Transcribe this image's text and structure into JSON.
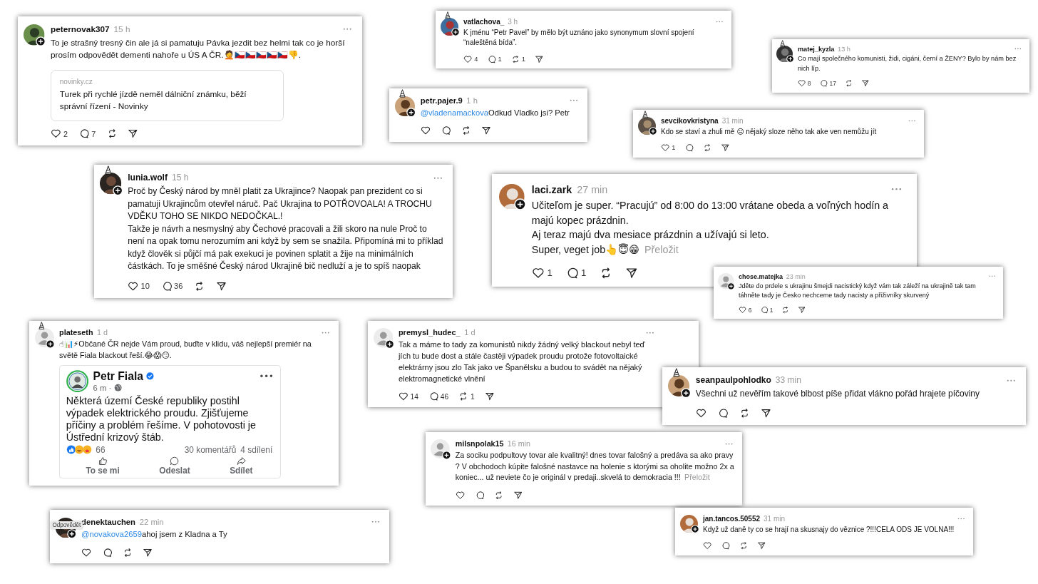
{
  "posts": [
    {
      "user": "peternovak307",
      "time": "15 h",
      "avatar": {
        "kind": "photo",
        "hat": false
      },
      "text": "To je strašný tresný čin ale já si pamatuju Pávka jezdit bez helmi tak co je horší prosím odpovědět dementi nahoře u ÚS A ČR.🤦🇨🇿🇨🇿🇨🇿🇨🇿🇨🇿👎.",
      "link_preview": {
        "source": "novinky.cz",
        "title": "Turek při rychlé jízdě neměl dálniční známku, běží správní řízení - Novinky"
      },
      "likes": "2",
      "comments": "7"
    },
    {
      "user": "vatlachova_",
      "time": "3 h",
      "avatar": {
        "kind": "photo",
        "hat": true
      },
      "text": "K jménu “Petr Pavel” by mělo být uznáno jako synonymum slovní spojení “naleštěná bída”.",
      "likes": "4",
      "comments": "1",
      "reposts": "1"
    },
    {
      "user": "matej_kyzla",
      "time": "13 h",
      "avatar": {
        "kind": "photo",
        "hat": true
      },
      "text": "Co mají společného komunisti, židi, cigáni, černí a ŽENY? Bylo by nám bez nich líp.",
      "likes": "8",
      "comments": "17"
    },
    {
      "user": "petr.pajer.9",
      "time": "1 h",
      "avatar": {
        "kind": "photo",
        "hat": true
      },
      "mention": "@vladenamackova",
      "text": "Odkud Vladko jsi? Petr"
    },
    {
      "user": "sevcikovkristyna",
      "time": "31 min",
      "avatar": {
        "kind": "photo",
        "hat": true
      },
      "text": "Kdo se staví a zhuli mě 😑 nějaký sloze něho tak ake ven nemůžu jít",
      "likes": "1"
    },
    {
      "user": "lunia.wolf",
      "time": "15 h",
      "avatar": {
        "kind": "photo",
        "hat": true
      },
      "text": "Proč by Český národ by mněl platit za Ukrajince? Naopak pan prezident co si pamatuji Ukrajincům otevřel náruč. Pač Ukrajina to POTŘOVOALA! A TROCHU VDĚKU TOHO SE NIKDO NEDOČKAL.!\nTakže je návrh a nesmyslný aby Čechové pracovali a žili skoro na nule Proč to není na opak tomu nerozumím ani když by sem se snažila. Připomíná mi to příklad když člověk si půjčí má pak exekuci je povinen splatit a žije na minimálních částkách. To je směšné Český národ Ukrajině bič nedluží a je to spíš naopak",
      "likes": "10",
      "comments": "36"
    },
    {
      "user": "laci.zark",
      "time": "27 min",
      "avatar": {
        "kind": "photo",
        "hat": false
      },
      "text": "Učiteľom je super. “Pracujú” od 8:00 do 13:00 vrátane obeda a voľných hodín a majú kopec prázdnin.\nAj teraz majú dva mesiace prázdnin a užívajú si leto.\nSuper, veget job👆😇😁",
      "translate": "Přeložit",
      "likes": "1",
      "comments": "1"
    },
    {
      "user": "chose.matejka",
      "time": "23 min",
      "avatar": {
        "kind": "silhouette",
        "hat": false
      },
      "text": "Jděte do prdele s ukrajinu šmejdi nacistický když vám tak záleží na ukrajině tak tam táhněte tady je Česko nechceme tady nacisty a přiživníky skurvený",
      "likes": "6",
      "comments": "1"
    },
    {
      "user": "plateseth",
      "time": "1 d",
      "avatar": {
        "kind": "silhouette",
        "hat": true
      },
      "text": "☝📊⚡Občané ČR nejde Vám proud, buďte v klidu, váš nejlepší premiér na světě Fiala blackout řeší.😂😱😏.",
      "embed": {
        "author": "Petr Fiala",
        "verified": true,
        "time": "6 m ·",
        "text": "Některá území České republiky postihl výpadek elektrického proudu. Zjišťujeme příčiny a problém řešíme. V pohotovosti je Ústřední krizový štáb.",
        "reactions": "66",
        "comments": "30 komentářů",
        "shares": "4 sdílení",
        "actions": [
          {
            "kind": "like",
            "label": "To se mi"
          },
          {
            "kind": "send",
            "label": "Odeslat"
          },
          {
            "kind": "share",
            "label": "Sdílet"
          }
        ]
      }
    },
    {
      "user": "premysl_hudec_",
      "time": "1 d",
      "avatar": {
        "kind": "silhouette",
        "hat": false
      },
      "text": "Tak a máme to tady za komunistů nikdy žádný velký blackout nebyl teď jích tu bude dost a stále častěji výpadek proudu protože fotovoltaické elektrárny jsou zlo Tak jako ve Španělsku a budou to svádět na nějaký elektromagnetické vlnění",
      "likes": "14",
      "comments": "46",
      "reposts": "1"
    },
    {
      "user": "seanpaulpohlodko",
      "time": "33 min",
      "avatar": {
        "kind": "photo",
        "hat": true
      },
      "text": "Všechni už nevěřím takové blbost píše přidat vlákno pořád hrajete píčoviny"
    },
    {
      "user": "milsnpolak15",
      "time": "16 min",
      "avatar": {
        "kind": "silhouette",
        "hat": false
      },
      "text": "Za sociku podpultovy tovar ale kvalitný! dnes tovar falošný a predáva sa ako pravy ? V obchodoch kúpite falošné nastavce na holenie s ktorými sa oholite možno 2x a koniec... už neviete čo je originál v predaji..skvelá to demokracia !!!",
      "translate": "Přeložit"
    },
    {
      "user": "denektauchen",
      "time": "22 min",
      "avatar": {
        "kind": "photo",
        "hat": false
      },
      "tooltip": "Odpovědět",
      "mention": "@novakova2659",
      "text": "ahoj jsem z Kladna a Ty"
    },
    {
      "user": "jan.tancos.50552",
      "time": "31 min",
      "avatar": {
        "kind": "photo",
        "hat": false
      },
      "text": "Když už daně ty co se hrají na skusnajy do věznice ?!!!CELA ODS JE VOLNA!!!"
    }
  ]
}
